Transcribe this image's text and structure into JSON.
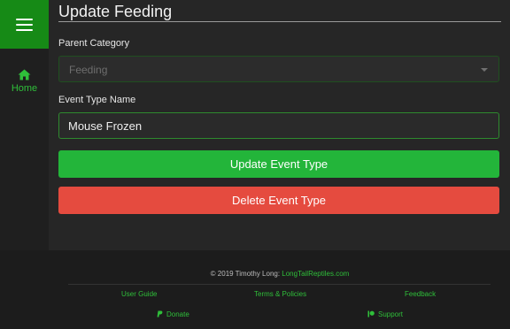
{
  "sidebar": {
    "menu_icon": "hamburger-icon",
    "home": {
      "icon": "home-icon",
      "label": "Home"
    }
  },
  "form": {
    "title": "Update Feeding",
    "parent_category": {
      "label": "Parent Category",
      "value": "Feeding"
    },
    "event_type_name": {
      "label": "Event Type Name",
      "value": "Mouse Frozen"
    },
    "update_button": "Update Event Type",
    "delete_button": "Delete Event Type"
  },
  "footer": {
    "copyright_prefix": "© 2019 Timothy Long: ",
    "site_link": "LongTailReptiles.com",
    "links": {
      "user_guide": "User Guide",
      "terms": "Terms & Policies",
      "feedback": "Feedback",
      "donate": "Donate",
      "support": "Support"
    }
  },
  "colors": {
    "accent_green": "#23b53a",
    "danger_red": "#e54b3f",
    "menu_green": "#168a16"
  }
}
